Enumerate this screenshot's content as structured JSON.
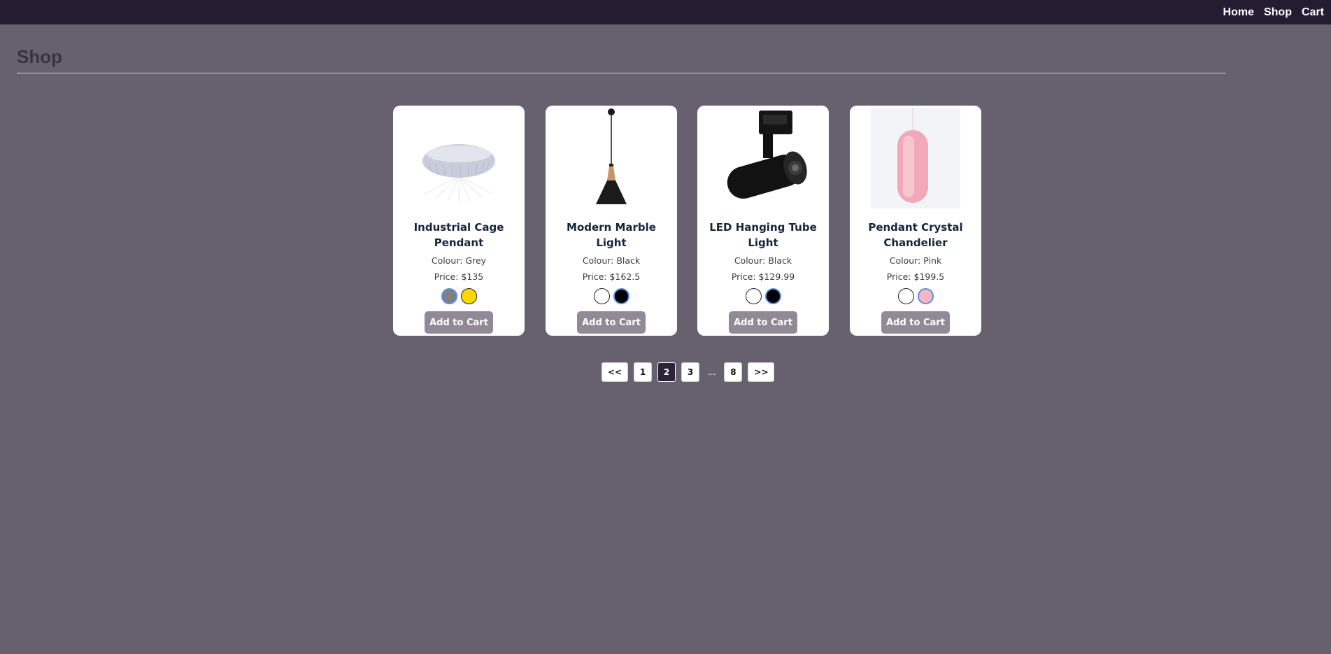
{
  "nav": {
    "home": "Home",
    "shop": "Shop",
    "cart": "Cart"
  },
  "page_title": "Shop",
  "products": [
    {
      "name": "Industrial Cage Pendant",
      "colour": "Colour: Grey",
      "price": "Price: $135",
      "button": "Add to Cart",
      "swatches": [
        "#808080",
        "#ffd700"
      ],
      "selected_swatch": 0
    },
    {
      "name": "Modern Marble Light",
      "colour": "Colour: Black",
      "price": "Price: $162.5",
      "button": "Add to Cart",
      "swatches": [
        "#ffffff",
        "#000000"
      ],
      "selected_swatch": 1
    },
    {
      "name": "LED Hanging Tube Light",
      "colour": "Colour: Black",
      "price": "Price: $129.99",
      "button": "Add to Cart",
      "swatches": [
        "#ffffff",
        "#000000"
      ],
      "selected_swatch": 1
    },
    {
      "name": "Pendant Crystal Chandelier",
      "colour": "Colour: Pink",
      "price": "Price: $199.5",
      "button": "Add to Cart",
      "swatches": [
        "#ffffff",
        "#f4b6c2"
      ],
      "selected_swatch": 1
    }
  ],
  "pagination": {
    "prev": "<<",
    "pages": [
      "1",
      "2",
      "3"
    ],
    "ellipsis": "...",
    "last": "8",
    "next": ">>",
    "current": "2"
  },
  "colors": {
    "navbar": "#251c31",
    "background": "#67616f",
    "button": "#908a96",
    "active_page": "#2b2336"
  }
}
